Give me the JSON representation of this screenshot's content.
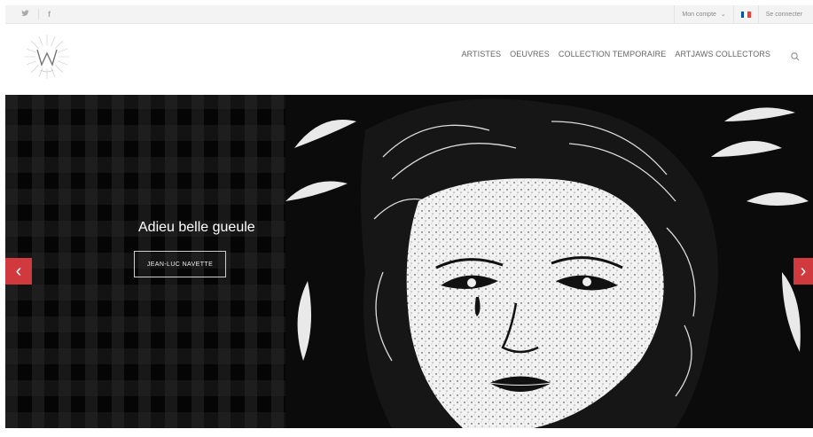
{
  "topbar": {
    "social": [
      {
        "name": "twitter-icon",
        "glyph": "𝕥"
      },
      {
        "name": "facebook-icon",
        "glyph": "f"
      }
    ],
    "account_label": "Mon compte",
    "account_caret": "⌄",
    "login_label": "Se connecter",
    "flag_colors": [
      "#0055A4",
      "#FFFFFF",
      "#EF4135"
    ]
  },
  "header": {
    "nav": [
      {
        "label": "ARTISTES"
      },
      {
        "label": "OEUVRES"
      },
      {
        "label": "COLLECTION TEMPORAIRE"
      },
      {
        "label": "ARTJAWS COLLECTORS"
      }
    ],
    "search_icon": "search-icon"
  },
  "slider": {
    "title": "Adieu belle gueule",
    "button_label": "JEAN-LUC NAVETTE",
    "prev_glyph": "‹",
    "next_glyph": "›",
    "accent": "#d03a3f"
  }
}
